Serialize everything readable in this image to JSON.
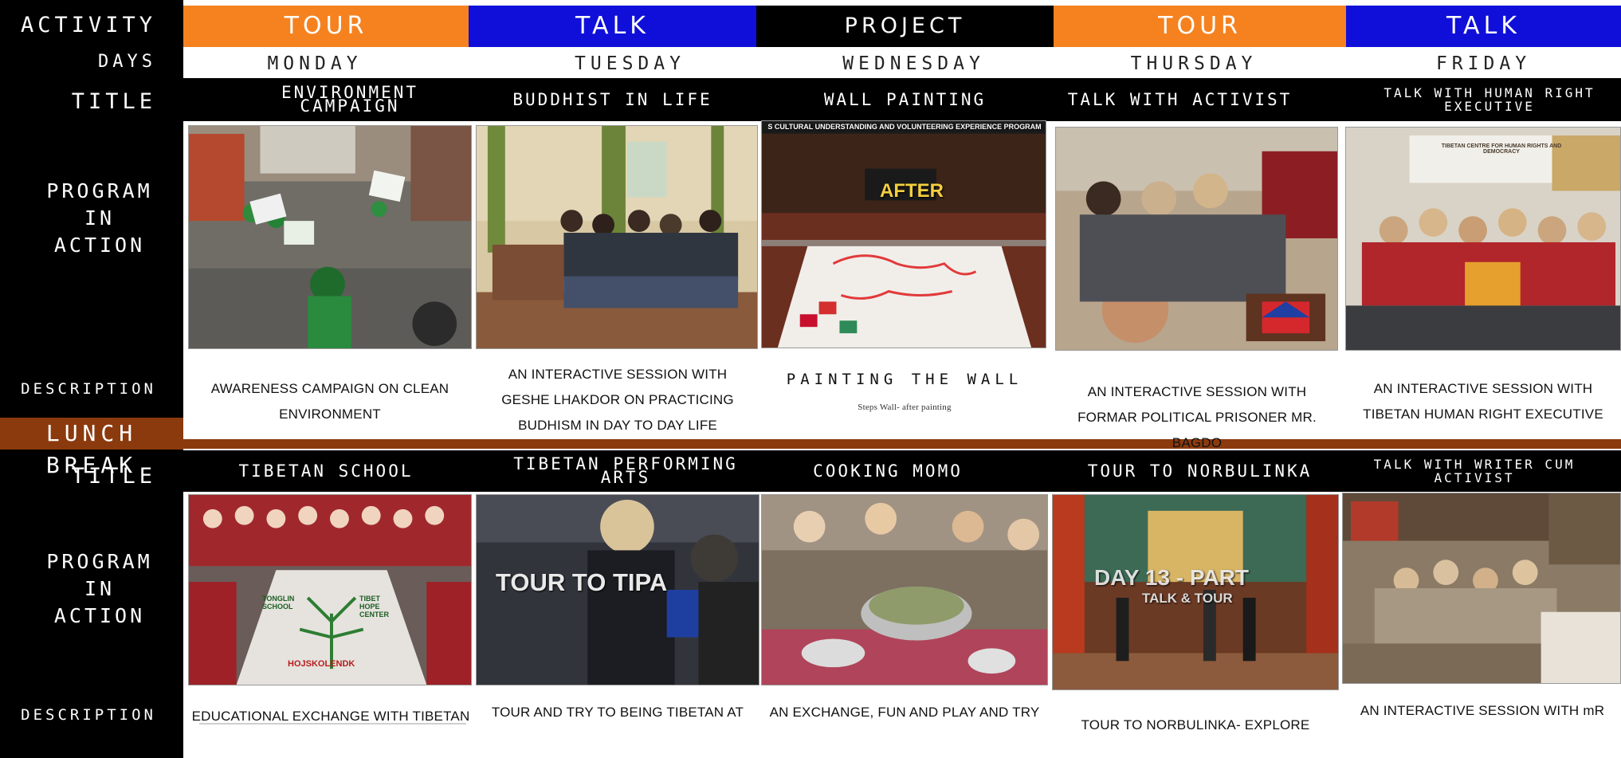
{
  "sidebar": {
    "activity": "ACTIVITY",
    "days": "DAYS",
    "title": "TITLE",
    "program": [
      "PROGRAM",
      "IN",
      "ACTION"
    ],
    "description": "DESCRIPTION",
    "lunch": "LUNCH BREAK"
  },
  "colors": {
    "tour": "#f5821f",
    "talk": "#0f0fd9",
    "project": "#000000",
    "lunch": "#8b3a0e"
  },
  "columns": [
    {
      "activity": "TOUR",
      "day": "MONDAY",
      "title1": "ENVIRONMENT CAMPAIGN",
      "desc1": "AWARENESS CAMPAIGN ON CLEAN ENVIRONMENT",
      "title2": "TIBETAN SCHOOL",
      "desc2": "EDUCATIONAL EXCHANGE WITH TIBETAN"
    },
    {
      "activity": "TALK",
      "day": "TUESDAY",
      "title1": "BUDDHIST IN LIFE",
      "desc1": "AN INTERACTIVE SESSION WITH GESHE LHAKDOR  ON PRACTICING BUDHISM IN DAY TO DAY LIFE",
      "title2": "TIBETAN PERFORMING ARTS",
      "desc2": "TOUR AND TRY  TO BEING TIBETAN  AT"
    },
    {
      "activity": "PROJECT",
      "day": "WEDNESDAY",
      "title1": "WALL PAINTING",
      "desc1": "PAINTING  THE WALL",
      "desc1_sub": "Steps Wall- after painting",
      "title2": "COOKING MOMO",
      "desc2": "AN EXCHANGE, FUN AND PLAY AND TRY"
    },
    {
      "activity": "TOUR",
      "day": "THURSDAY",
      "title1": "TALK WITH ACTIVIST",
      "desc1": "AN INTERACTIVE SESSION WITH FORMAR POLITICAL PRISONER MR.  BAGDO",
      "title2": "TOUR TO NORBULINKA",
      "desc2": "TOUR TO NORBULINKA- EXPLORE"
    },
    {
      "activity": "TALK",
      "day": "FRIDAY",
      "title1": "TALK WITH HUMAN RIGHT EXECUTIVE",
      "desc1": "AN INTERACTIVE SESSION WITH TIBETAN HUMAN RIGHT EXECUTIVE",
      "title2": "TALK WITH WRITER CUM ACTIVIST",
      "desc2": "AN INTERACTIVE SESSION WITH mR"
    }
  ],
  "photo_text": {
    "wall_banner": "S CULTURAL UNDERSTANDING AND VOLUNTEERING EXPERIENCE PROGRAM",
    "after": "AFTER",
    "tipa": "TOUR TO TIPA",
    "day13": "DAY 13 - PART",
    "talk_tour": "TALK & TOUR",
    "tchrd": "TIBETAN CENTRE FOR HUMAN RIGHTS AND DEMOCRACY",
    "school_left": "TONGLIN SCHOOL",
    "school_right": "TIBET HOPE CENTER",
    "hojskolen": "HOJSKOLENDK"
  }
}
